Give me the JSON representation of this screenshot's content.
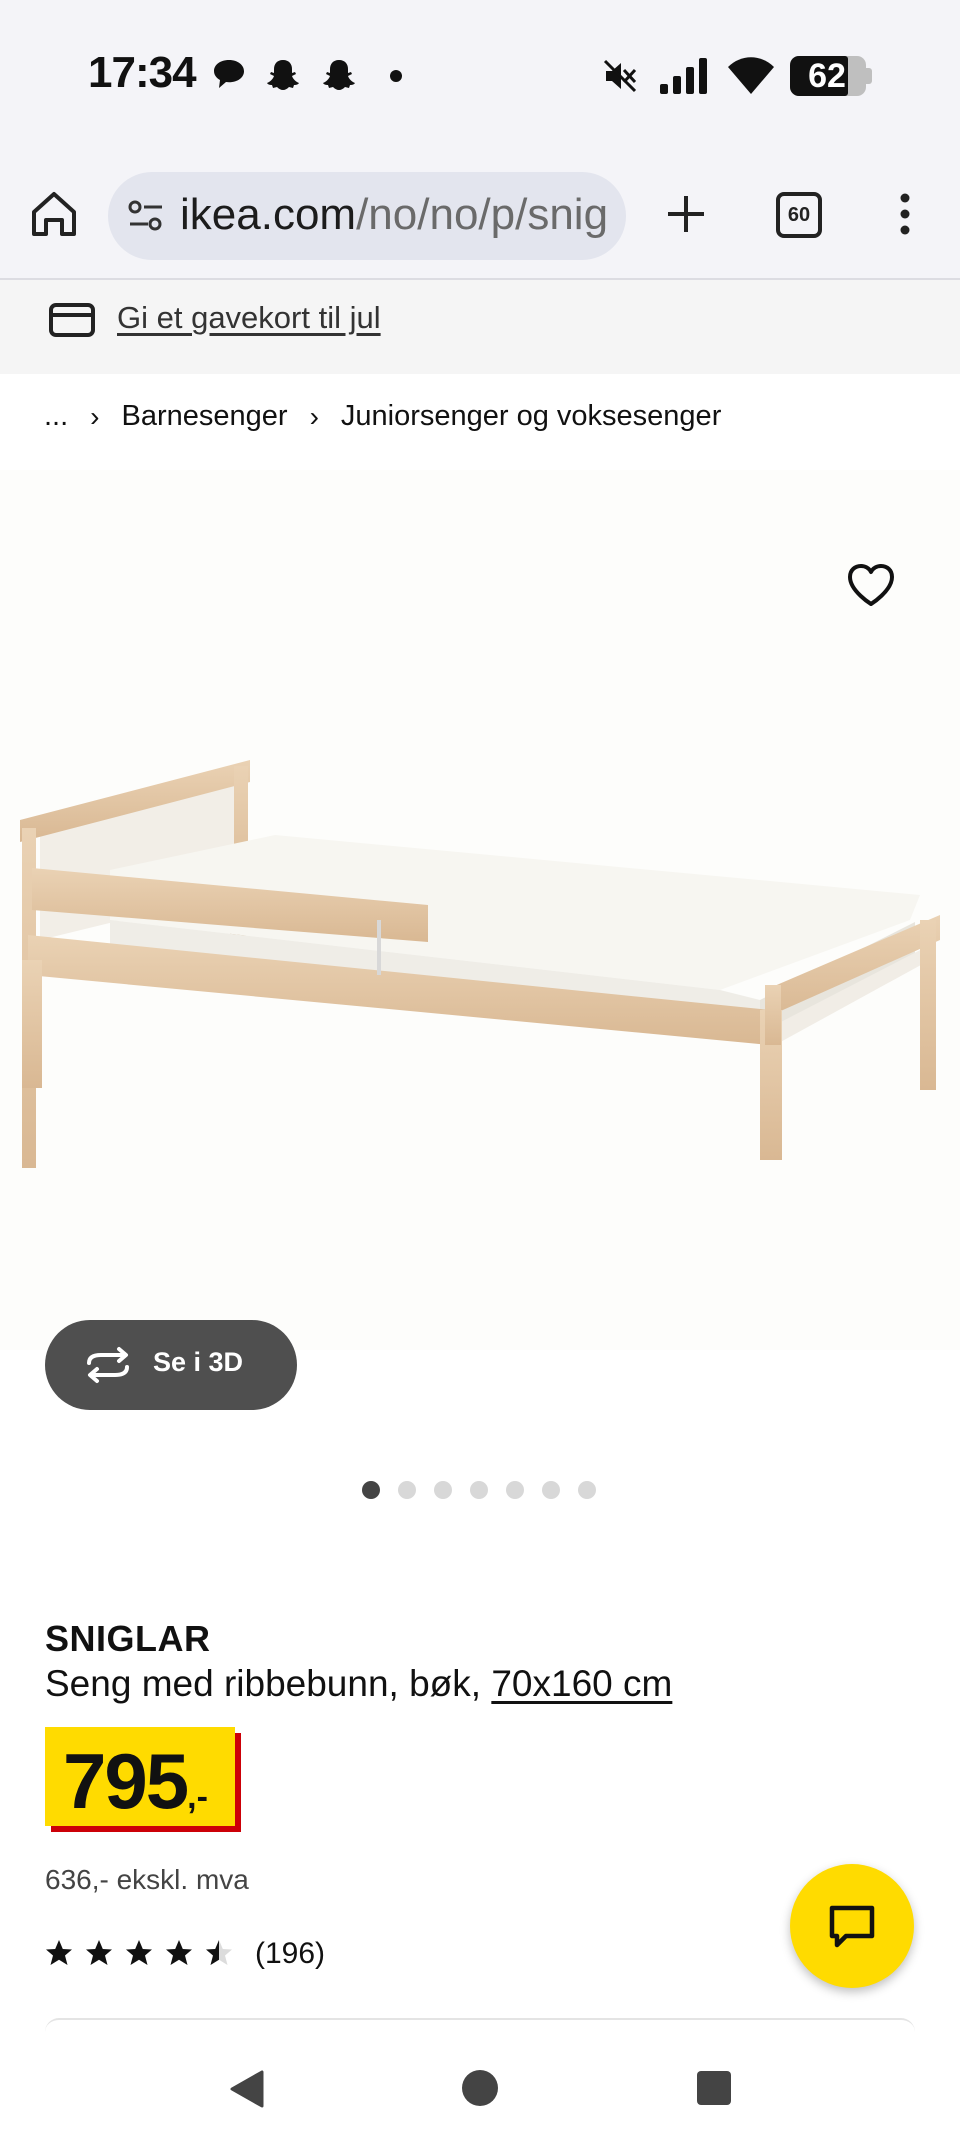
{
  "status_bar": {
    "time": "17:34",
    "notification_icons": [
      "chat-bubble-icon",
      "snapchat-icon",
      "snapchat-icon",
      "dot-icon"
    ],
    "system_icons": [
      "mute-icon",
      "signal-icon",
      "wifi-icon"
    ],
    "battery": "62"
  },
  "browser": {
    "url_host": "ikea.com",
    "url_path": "/no/no/p/snig",
    "tab_count": "60"
  },
  "gift_banner": {
    "label": "Gi et gavekort til jul"
  },
  "breadcrumb": {
    "ellipsis": "...",
    "items": [
      "Barnesenger",
      "Juniorsenger og voksesenger"
    ]
  },
  "gallery": {
    "see_3d_label": "Se i 3D",
    "dot_count": 7,
    "active_index": 0
  },
  "product": {
    "name": "SNIGLAR",
    "description": "Seng med ribbebunn, bøk, ",
    "size": "70x160 cm",
    "price": "795",
    "price_suffix": ",-",
    "price_ex_vat": "636,- ekskl. mva",
    "rating": 4.5,
    "rating_max": 5,
    "review_count": "(196)"
  },
  "colors": {
    "price_yellow": "#ffdb00",
    "price_red": "#cc0008",
    "button_dark": "#4f4f4f"
  }
}
